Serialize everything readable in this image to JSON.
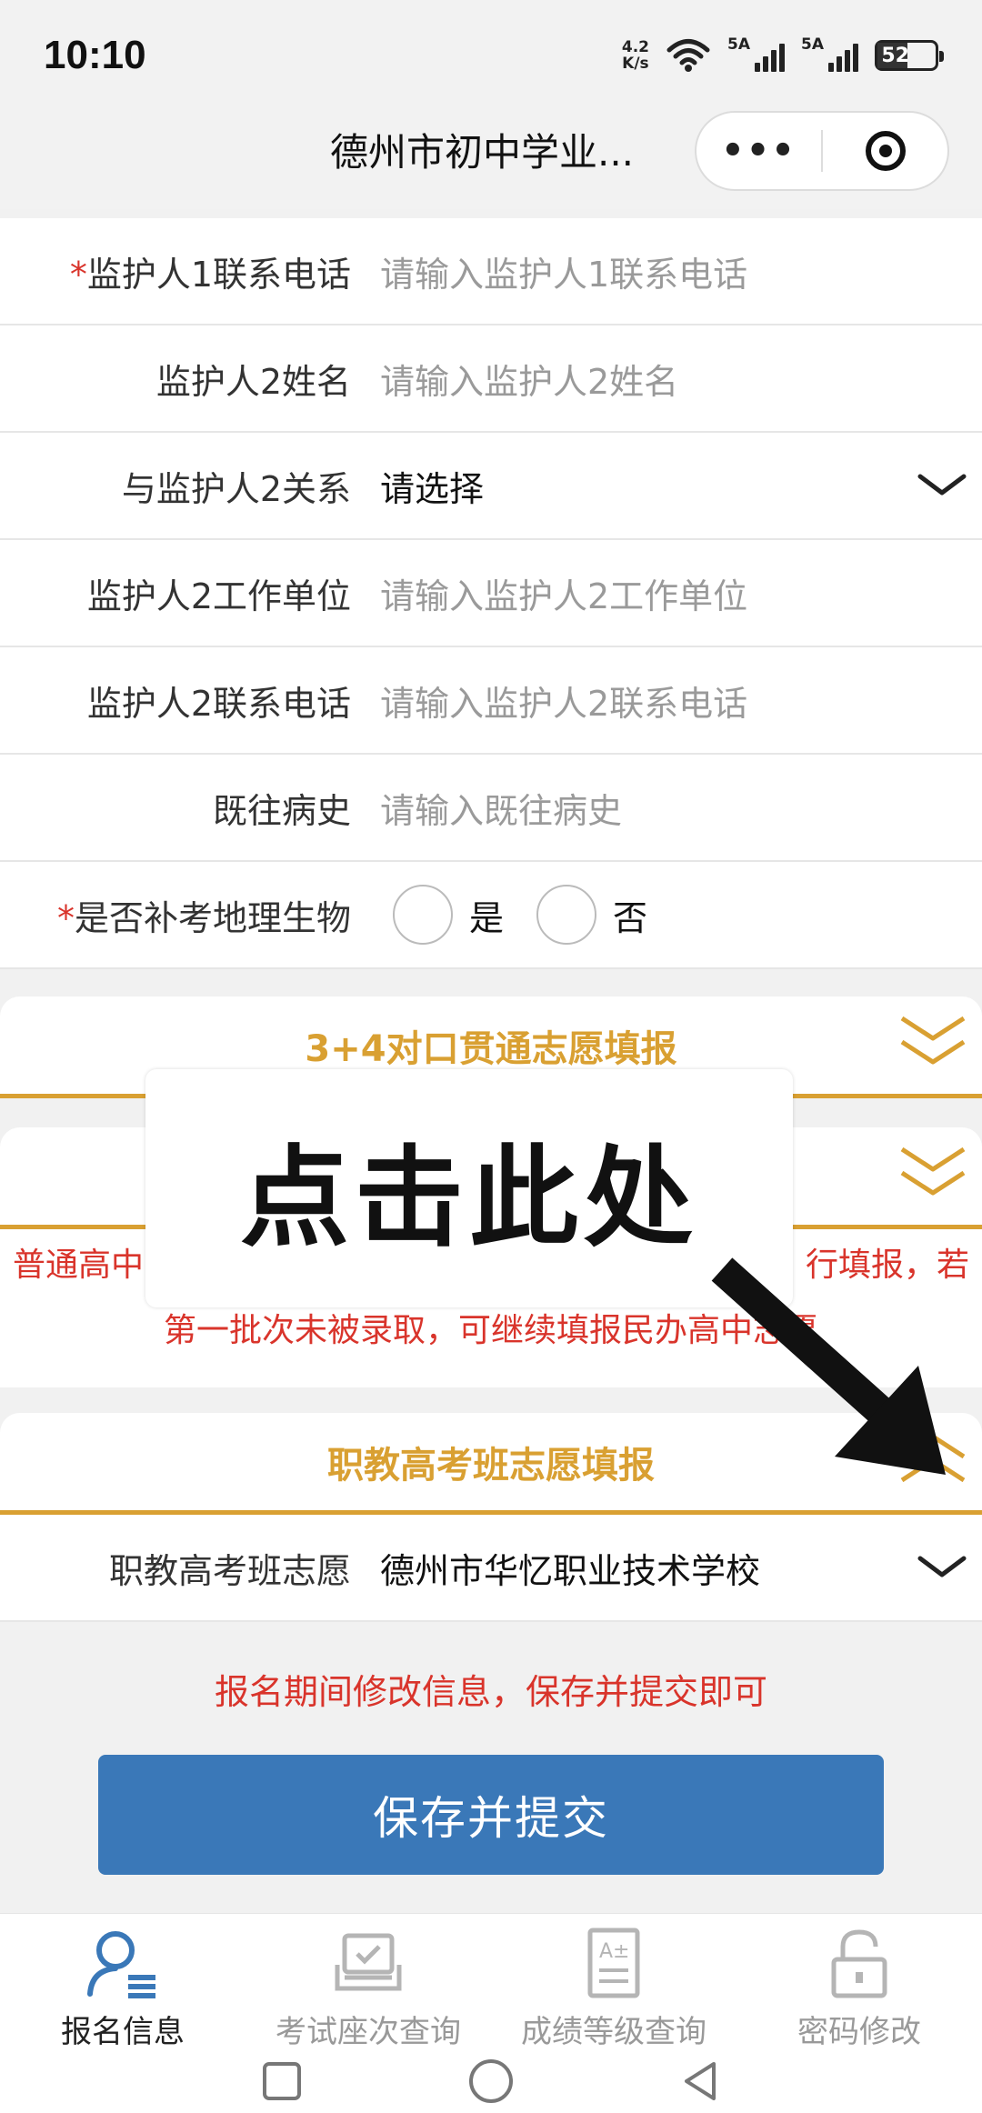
{
  "status": {
    "time": "10:10",
    "net_speed_value": "4.2",
    "net_speed_unit": "K/s",
    "sim1": "5A",
    "sim2": "5A",
    "battery": "52"
  },
  "header": {
    "title": "德州市初中学业..."
  },
  "form": {
    "rows": [
      {
        "label": "监护人1联系电话",
        "required": "*",
        "placeholder": "请输入监护人1联系电话"
      },
      {
        "label": "监护人2姓名",
        "placeholder": "请输入监护人2姓名"
      },
      {
        "label": "与监护人2关系",
        "value": "请选择"
      },
      {
        "label": "监护人2工作单位",
        "placeholder": "请输入监护人2工作单位"
      },
      {
        "label": "监护人2联系电话",
        "placeholder": "请输入监护人2联系电话"
      },
      {
        "label": "既往病史",
        "placeholder": "请输入既往病史"
      },
      {
        "label": "是否补考地理生物",
        "required": "*",
        "options": [
          "是",
          "否"
        ]
      }
    ]
  },
  "sections": {
    "s1": {
      "title": "3+4对口贯通志愿填报"
    },
    "s2": {
      "notice_line1_left": "普通高中",
      "notice_line1_right": "行填报，若",
      "notice_line2": "第一批次未被录取，可继续填报民办高中志愿"
    },
    "s3": {
      "title": "职教高考班志愿填报",
      "row_label": "职教高考班志愿",
      "row_value": "德州市华忆职业技术学校"
    }
  },
  "overlay": {
    "text": "点击此处"
  },
  "hint": "报名期间修改信息，保存并提交即可",
  "submit_label": "保存并提交",
  "tabbar": [
    {
      "label": "报名信息",
      "icon": "user-list-icon",
      "active": true
    },
    {
      "label": "考试座次查询",
      "icon": "seat-icon"
    },
    {
      "label": "成绩等级查询",
      "icon": "grade-doc-icon"
    },
    {
      "label": "密码修改",
      "icon": "lock-icon"
    }
  ],
  "colors": {
    "accent": "#d9a032",
    "warning": "#d9342b",
    "primary": "#3a78b8"
  }
}
